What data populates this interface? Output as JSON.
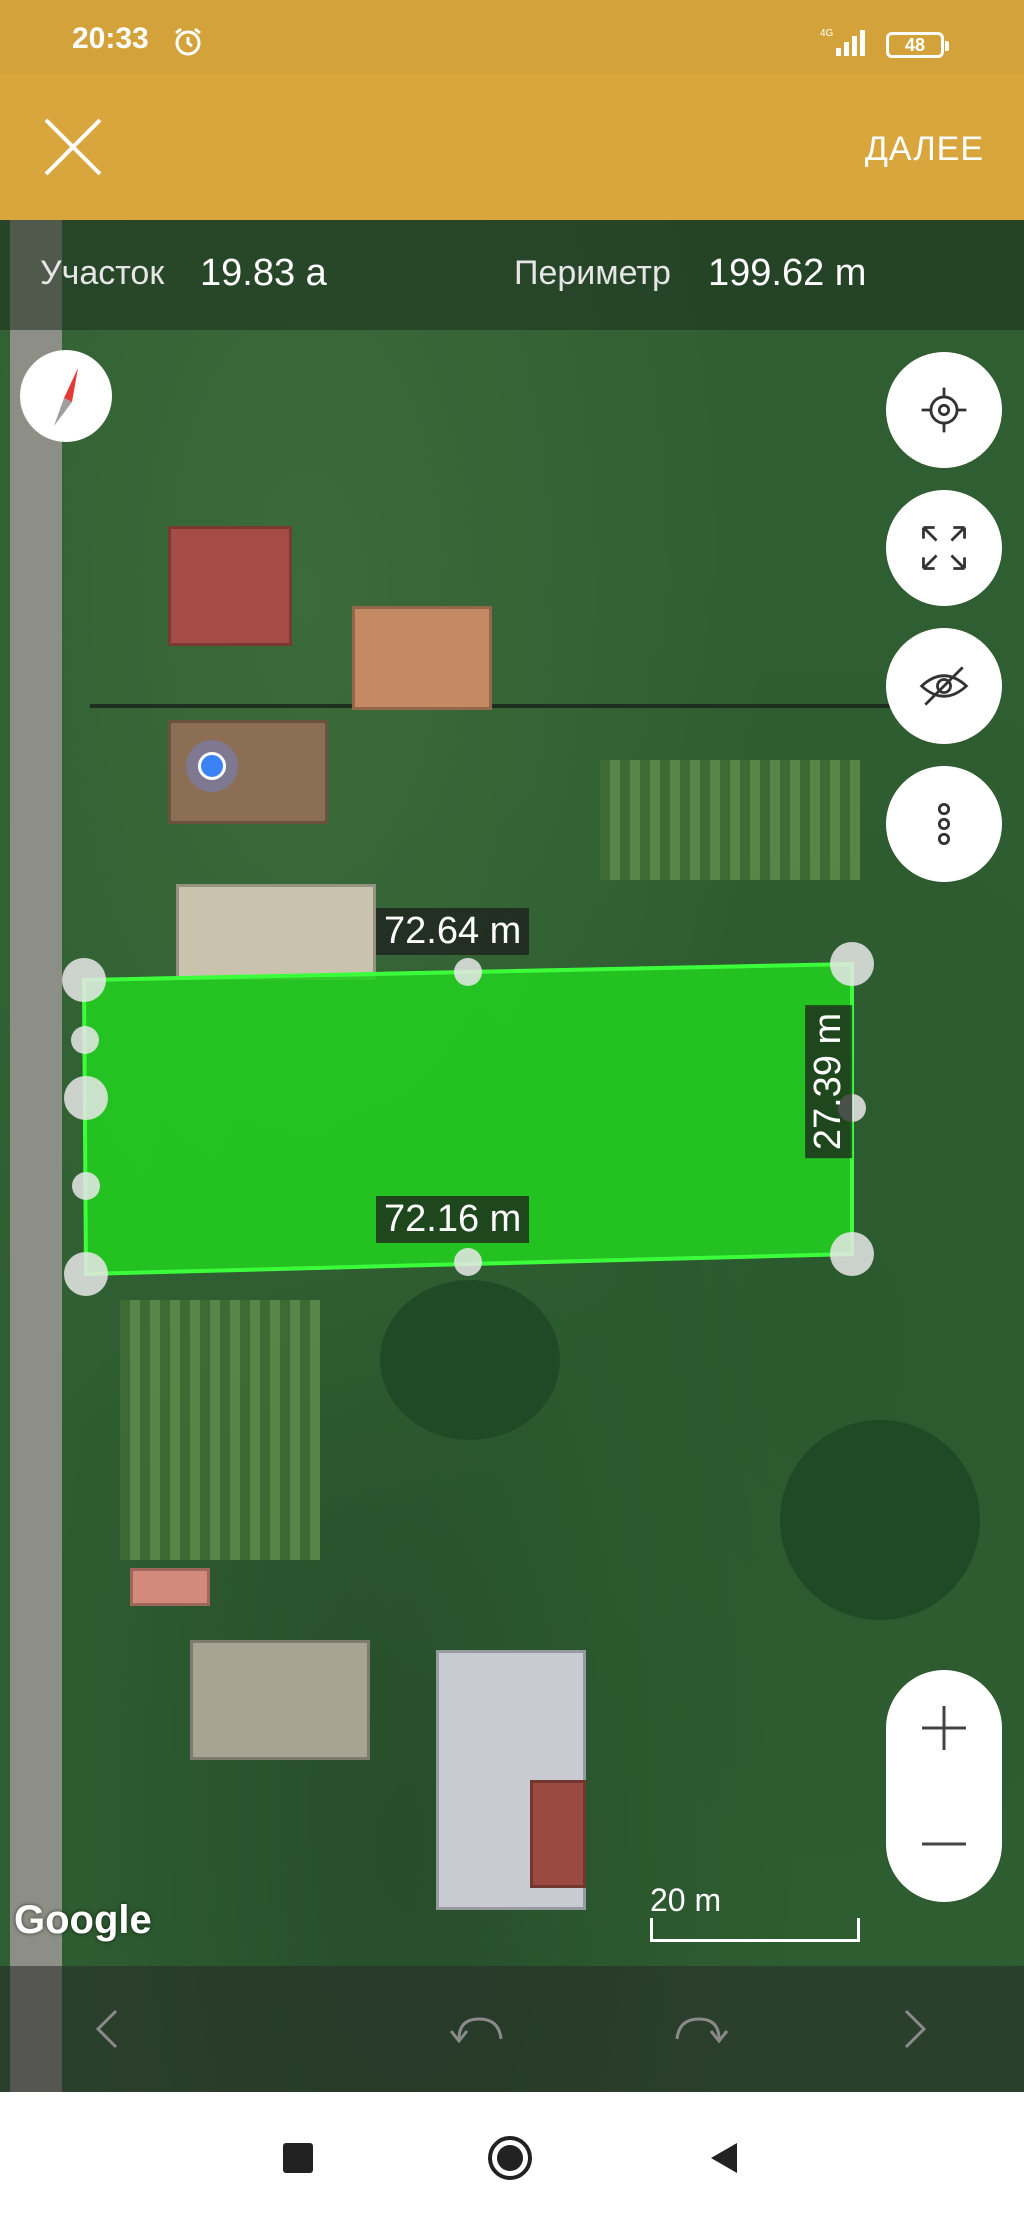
{
  "status_bar": {
    "time": "20:33",
    "network": "4G",
    "battery": "48"
  },
  "app_bar": {
    "next_label": "ДАЛЕЕ"
  },
  "info": {
    "area_label": "Участок",
    "area_value": "19.83 a",
    "perimeter_label": "Периметр",
    "perimeter_value": "199.62 m"
  },
  "plot": {
    "top_edge": "72.64 m",
    "bottom_edge": "72.16 m",
    "right_edge": "27.39 m",
    "fill_color": "#22d41e"
  },
  "map": {
    "attribution": "Google",
    "scale_label": "20 m"
  },
  "icons": {
    "compass": "compass-icon",
    "locate": "crosshair-icon",
    "fit": "expand-icon",
    "visibility": "eye-off-icon",
    "more": "more-vertical-icon",
    "zoom_in": "plus-icon",
    "zoom_out": "minus-icon",
    "prev": "chevron-left-icon",
    "undo": "undo-icon",
    "redo": "redo-icon",
    "next": "chevron-right-icon"
  }
}
